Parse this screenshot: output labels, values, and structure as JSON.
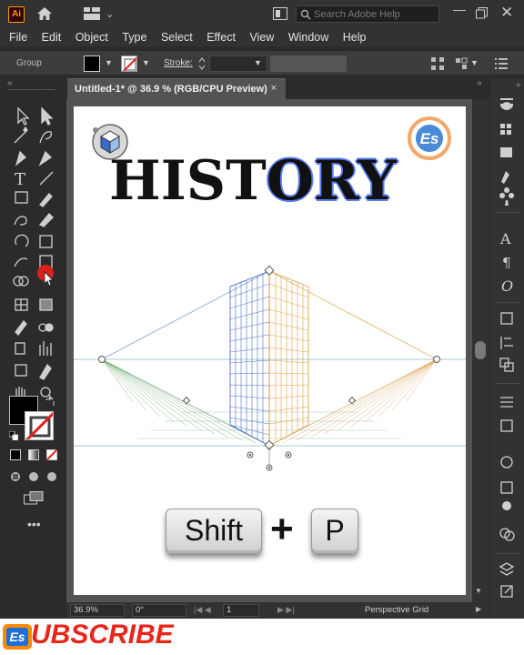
{
  "app": {
    "logo_text": "Ai"
  },
  "titlebar": {
    "search_placeholder": "Search Adobe Help"
  },
  "menu": [
    "File",
    "Edit",
    "Object",
    "Type",
    "Select",
    "Effect",
    "View",
    "Window",
    "Help"
  ],
  "control": {
    "selection_label": "Group",
    "stroke_label": "Stroke:"
  },
  "document": {
    "tab_title": "Untitled-1* @ 36.9 % (RGB/CPU Preview)",
    "close_glyph": "×"
  },
  "artboard": {
    "title_plain": "HIST",
    "title_selected": "ORY",
    "title_mid": "O",
    "shortcut_key1": "Shift",
    "shortcut_plus": "+",
    "shortcut_key2": "P"
  },
  "status": {
    "zoom": "36.9%",
    "rotation": "0°",
    "page": "1",
    "current_tool": "Perspective Grid"
  },
  "banner": {
    "text": "UBSCRIBE"
  },
  "colors": {
    "accent_orange": "#ff9a00",
    "subscribe_red": "#e8261a",
    "selection_blue": "#4a6cf0",
    "grid_blue": "#4a6ec9",
    "grid_orange": "#e0a040",
    "grid_green": "#5aa070"
  }
}
